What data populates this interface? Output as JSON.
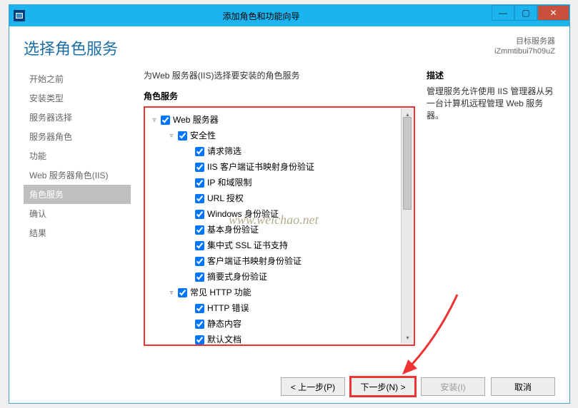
{
  "window": {
    "title": "添加角色和功能向导"
  },
  "header": {
    "page_title": "选择角色服务",
    "target_label": "目标服务器",
    "target_value": "iZmmtibui7h09uZ"
  },
  "sidebar": {
    "items": [
      {
        "label": "开始之前"
      },
      {
        "label": "安装类型"
      },
      {
        "label": "服务器选择"
      },
      {
        "label": "服务器角色"
      },
      {
        "label": "功能"
      },
      {
        "label": "Web 服务器角色(IIS)"
      },
      {
        "label": "角色服务"
      },
      {
        "label": "确认"
      },
      {
        "label": "结果"
      }
    ],
    "active_index": 6
  },
  "content": {
    "prompt": "为Web 服务器(IIS)选择要安装的角色服务",
    "section_label": "角色服务",
    "desc_label": "描述",
    "desc_text": "管理服务允许使用 IIS 管理器从另一台计算机远程管理 Web 服务器。"
  },
  "tree": [
    {
      "level": 0,
      "expander": "▿",
      "checked": true,
      "label": "Web 服务器"
    },
    {
      "level": 1,
      "expander": "▿",
      "checked": true,
      "label": "安全性"
    },
    {
      "level": 2,
      "expander": "",
      "checked": true,
      "label": "请求筛选"
    },
    {
      "level": 2,
      "expander": "",
      "checked": true,
      "label": "IIS 客户端证书映射身份验证"
    },
    {
      "level": 2,
      "expander": "",
      "checked": true,
      "label": "IP 和域限制"
    },
    {
      "level": 2,
      "expander": "",
      "checked": true,
      "label": "URL 授权"
    },
    {
      "level": 2,
      "expander": "",
      "checked": true,
      "label": "Windows 身份验证"
    },
    {
      "level": 2,
      "expander": "",
      "checked": true,
      "label": "基本身份验证"
    },
    {
      "level": 2,
      "expander": "",
      "checked": true,
      "label": "集中式 SSL 证书支持"
    },
    {
      "level": 2,
      "expander": "",
      "checked": true,
      "label": "客户端证书映射身份验证"
    },
    {
      "level": 2,
      "expander": "",
      "checked": true,
      "label": "摘要式身份验证"
    },
    {
      "level": 1,
      "expander": "▿",
      "checked": true,
      "label": "常见 HTTP 功能"
    },
    {
      "level": 2,
      "expander": "",
      "checked": true,
      "label": "HTTP 错误"
    },
    {
      "level": 2,
      "expander": "",
      "checked": true,
      "label": "静态内容"
    },
    {
      "level": 2,
      "expander": "",
      "checked": true,
      "label": "默认文档"
    }
  ],
  "buttons": {
    "prev": "< 上一步(P)",
    "next": "下一步(N) >",
    "install": "安装(I)",
    "cancel": "取消"
  },
  "watermark": "www.weichao.net"
}
